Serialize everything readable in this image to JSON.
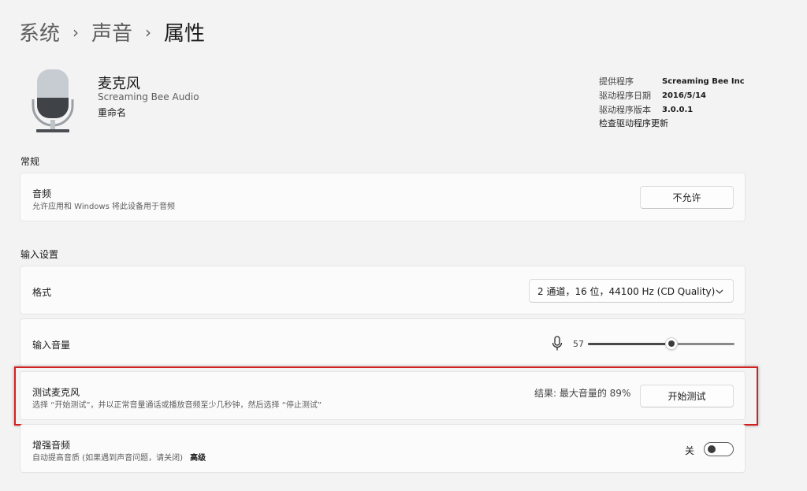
{
  "breadcrumb": {
    "items": [
      "系统",
      "声音",
      "属性"
    ],
    "separator": "›"
  },
  "device": {
    "name": "麦克风",
    "vendor": "Screaming Bee Audio",
    "rename": "重命名",
    "icon": "microphone-icon"
  },
  "driver": {
    "rows": [
      {
        "label": "提供程序",
        "value": "Screaming Bee Inc"
      },
      {
        "label": "驱动程序日期",
        "value": "2016/5/14"
      },
      {
        "label": "驱动程序版本",
        "value": "3.0.0.1"
      }
    ],
    "check_update": "检查驱动程序更新"
  },
  "general": {
    "title": "常规",
    "audio": {
      "title": "音频",
      "description": "允许应用和 Windows 将此设备用于音频",
      "button": "不允许"
    }
  },
  "input_settings": {
    "title": "输入设置",
    "format": {
      "title": "格式",
      "selected": "2 通道，16 位，44100 Hz (CD Quality)"
    },
    "volume": {
      "title": "输入音量",
      "value": "57",
      "level": 0.57
    },
    "test": {
      "title": "测试麦克风",
      "description": "选择 “开始测试”，并以正常音量通话或播放音频至少几秒钟，然后选择 “停止测试”",
      "result": "结果: 最大音量的 89%",
      "button": "开始测试"
    },
    "enhance": {
      "title": "增强音频",
      "description": "自动提高音质 (如果遇到声音问题，请关闭)",
      "advanced": "高级",
      "toggle_state": "关",
      "toggle_on": false
    }
  },
  "colors": {
    "highlight": "#d42020",
    "background": "#f3f3f3",
    "card": "#fbfbfb"
  }
}
